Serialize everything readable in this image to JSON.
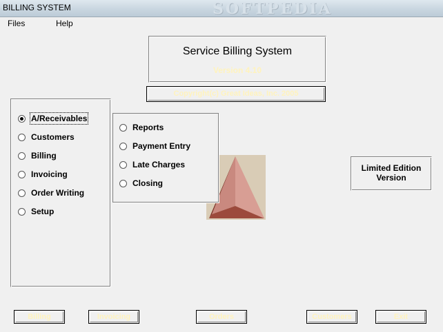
{
  "window": {
    "title": "BILLING SYSTEM",
    "watermark": "SOFTPEDIA"
  },
  "menu": {
    "items": [
      "Files",
      "Help"
    ]
  },
  "header": {
    "title": "Service Billing System",
    "version": "Version 4.10"
  },
  "copyright": "Copyright(c) Great Ideas, Inc. 2005",
  "main_options": [
    {
      "label": "A/Receivables",
      "checked": true
    },
    {
      "label": "Customers",
      "checked": false
    },
    {
      "label": "Billing",
      "checked": false
    },
    {
      "label": "Invoicing",
      "checked": false
    },
    {
      "label": "Order Writing",
      "checked": false
    },
    {
      "label": "Setup",
      "checked": false
    }
  ],
  "sub_options": [
    {
      "label": "Reports"
    },
    {
      "label": "Payment Entry"
    },
    {
      "label": "Late Charges"
    },
    {
      "label": "Closing"
    }
  ],
  "edition": {
    "line1": "Limited Edition",
    "line2": "Version"
  },
  "buttons": [
    "Billing",
    "Invoicing",
    "Orders",
    "Customers",
    "Exit"
  ],
  "colors": {
    "accent_text": "#fff3bd",
    "logo_bg": "#d9ccb6",
    "logo_fill": "#c9897f",
    "logo_dark": "#7a2f24"
  }
}
